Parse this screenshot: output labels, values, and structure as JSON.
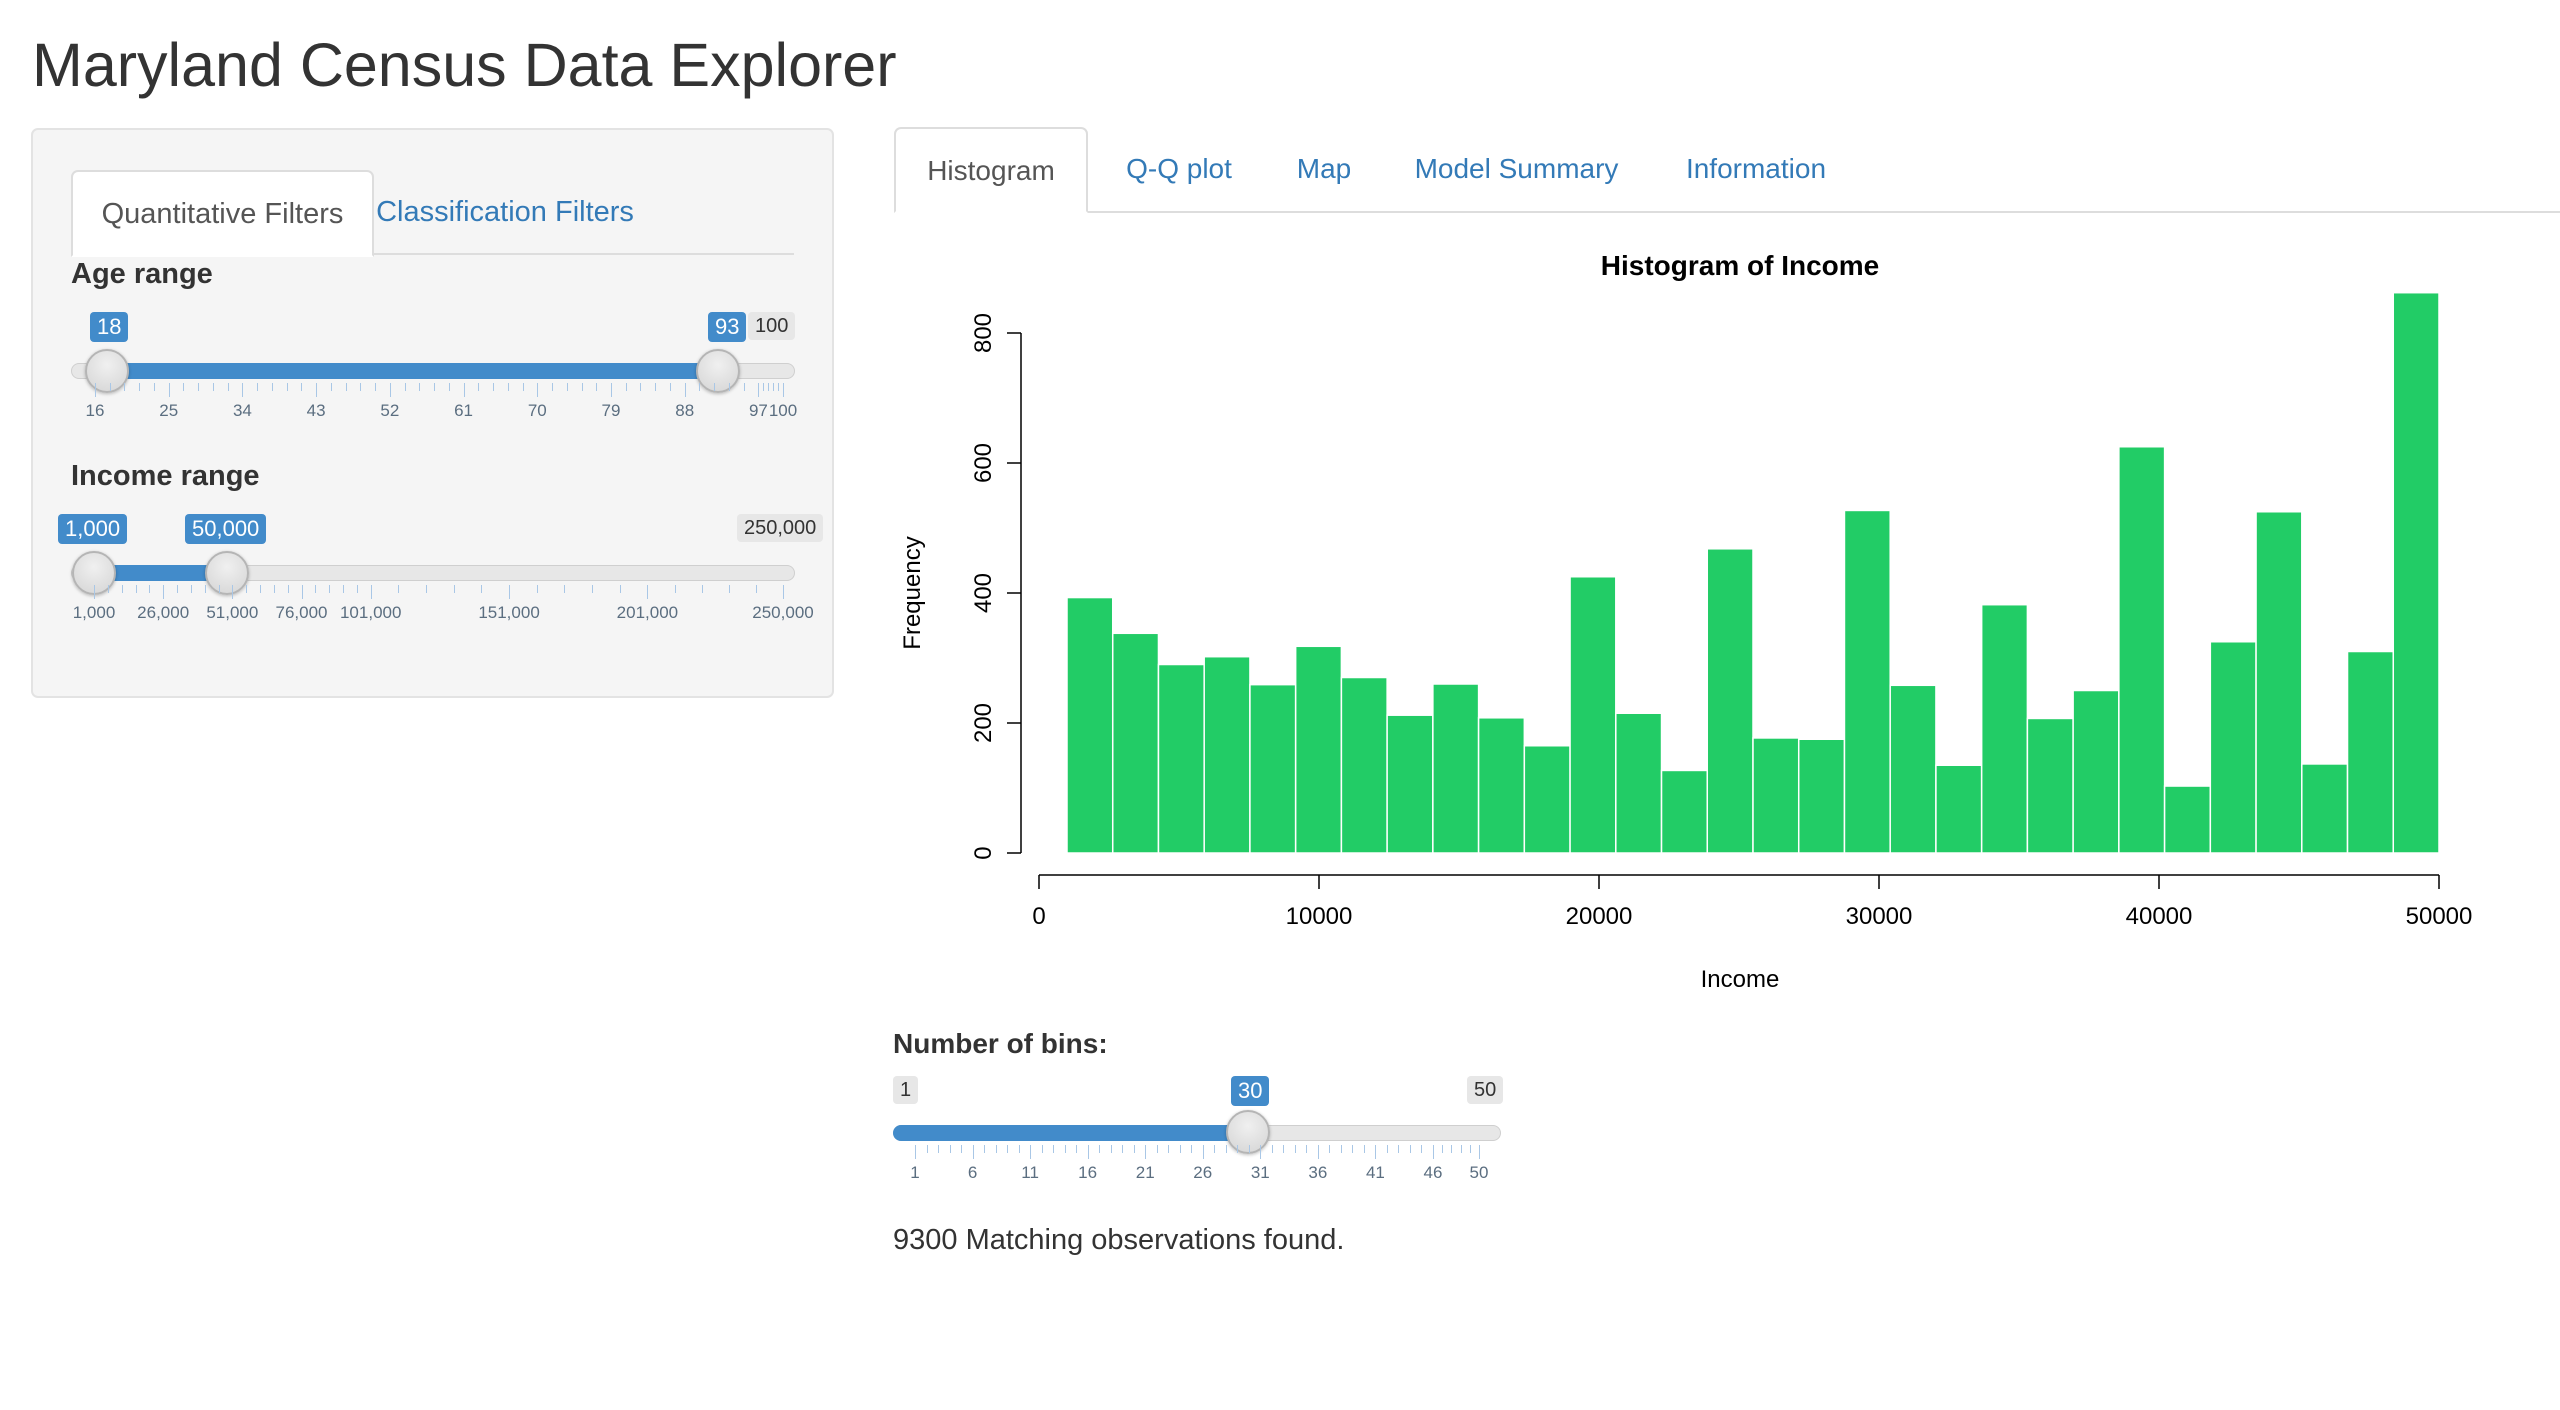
{
  "app": {
    "title": "Maryland Census Data Explorer"
  },
  "sidebar": {
    "tabs": [
      {
        "label": "Quantitative Filters",
        "active": true
      },
      {
        "label": "Classification Filters",
        "active": false
      }
    ],
    "age_slider": {
      "label": "Age range",
      "min": 16,
      "max": 100,
      "from": 18,
      "to": 93,
      "from_label": "18",
      "to_label": "93",
      "max_label": "100",
      "ticks": [
        "16",
        "25",
        "34",
        "43",
        "52",
        "61",
        "70",
        "79",
        "88",
        "97",
        "100"
      ]
    },
    "income_slider": {
      "label": "Income range",
      "min": 1000,
      "max": 250000,
      "from": 1000,
      "to": 50000,
      "from_label": "1,000",
      "to_label": "50,000",
      "max_label": "250,000",
      "ticks": [
        "1,000",
        "26,000",
        "51,000",
        "76,000",
        "101,000",
        "151,000",
        "201,000",
        "250,000"
      ]
    }
  },
  "main": {
    "tabs": [
      {
        "label": "Histogram",
        "active": true
      },
      {
        "label": "Q-Q plot",
        "active": false
      },
      {
        "label": "Map",
        "active": false
      },
      {
        "label": "Model Summary",
        "active": false
      },
      {
        "label": "Information",
        "active": false
      }
    ],
    "bins_slider": {
      "label": "Number of bins:",
      "min": 1,
      "max": 50,
      "value": 30,
      "min_label": "1",
      "max_label": "50",
      "value_label": "30",
      "ticks": [
        "1",
        "6",
        "11",
        "16",
        "21",
        "26",
        "31",
        "36",
        "41",
        "46",
        "50"
      ]
    },
    "status": "9300 Matching observations found."
  },
  "chart_data": {
    "type": "bar",
    "title": "Histogram of Income",
    "xlabel": "Income",
    "ylabel": "Frequency",
    "xlim": [
      0,
      50000
    ],
    "ylim": [
      0,
      800
    ],
    "x_ticks": [
      "0",
      "10000",
      "20000",
      "30000",
      "40000",
      "50000"
    ],
    "y_ticks": [
      "0",
      "200",
      "400",
      "600",
      "800"
    ],
    "bin_start": 1000,
    "bin_width": 1633.33,
    "values": [
      393,
      338,
      290,
      302,
      259,
      318,
      270,
      212,
      260,
      208,
      165,
      425,
      215,
      127,
      468,
      177,
      175,
      527,
      258,
      135,
      382,
      207,
      250,
      625,
      103,
      325,
      525,
      137,
      310,
      862
    ],
    "bar_color": "#22cc66",
    "grid": false
  }
}
